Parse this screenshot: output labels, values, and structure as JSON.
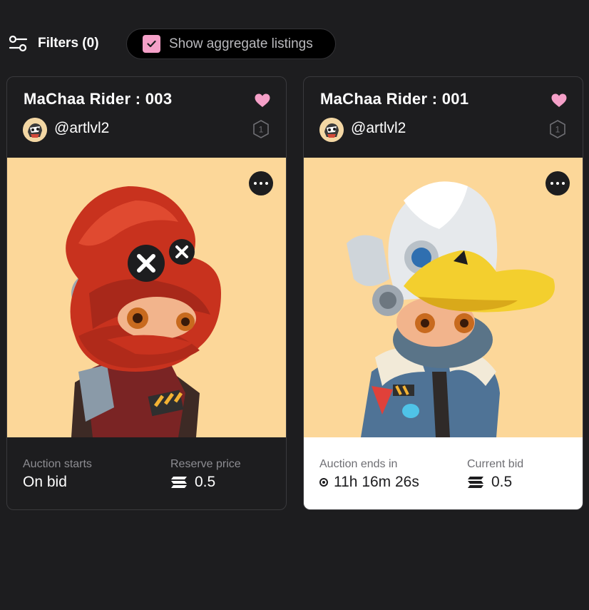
{
  "toolbar": {
    "filters_label": "Filters (0)",
    "aggregate_label": "Show aggregate listings",
    "aggregate_checked": true
  },
  "colors": {
    "background": "#1d1d1f",
    "accent_pink": "#f5a0c8",
    "art_background": "#fcd799"
  },
  "cards": [
    {
      "title": "MaChaa Rider : 003",
      "handle": "@artlvl2",
      "edition": "1",
      "favorited": true,
      "footer": {
        "left_label": "Auction starts",
        "left_value": "On bid",
        "right_label": "Reserve price",
        "right_value": "0.5",
        "right_icon": "solana-icon"
      }
    },
    {
      "title": "MaChaa Rider : 001",
      "handle": "@artlvl2",
      "edition": "1",
      "favorited": true,
      "footer": {
        "left_label": "Auction ends in",
        "left_value": "11h 16m 26s",
        "left_icon": "live-dot-icon",
        "right_label": "Current bid",
        "right_value": "0.5",
        "right_icon": "solana-icon"
      }
    }
  ]
}
